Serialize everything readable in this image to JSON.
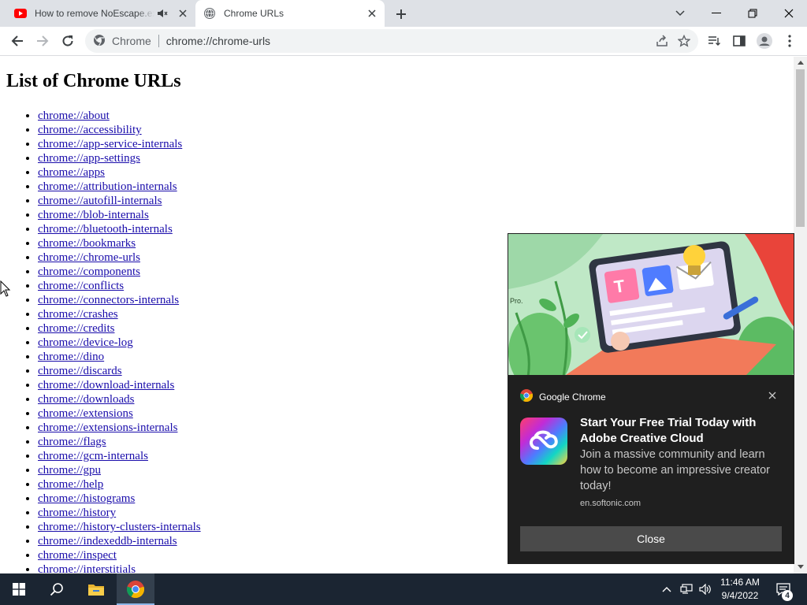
{
  "tabs": [
    {
      "title": "How to remove NoEscape.exe",
      "favicon": "youtube-icon",
      "extra_icon": "speaker-muted-icon",
      "active": false
    },
    {
      "title": "Chrome URLs",
      "favicon": "globe-icon",
      "active": true
    }
  ],
  "address_bar": {
    "site_chip": "Chrome",
    "url": "chrome://chrome-urls"
  },
  "page": {
    "heading": "List of Chrome URLs",
    "links": [
      "chrome://about",
      "chrome://accessibility",
      "chrome://app-service-internals",
      "chrome://app-settings",
      "chrome://apps",
      "chrome://attribution-internals",
      "chrome://autofill-internals",
      "chrome://blob-internals",
      "chrome://bluetooth-internals",
      "chrome://bookmarks",
      "chrome://chrome-urls",
      "chrome://components",
      "chrome://conflicts",
      "chrome://connectors-internals",
      "chrome://crashes",
      "chrome://credits",
      "chrome://device-log",
      "chrome://dino",
      "chrome://discards",
      "chrome://download-internals",
      "chrome://downloads",
      "chrome://extensions",
      "chrome://extensions-internals",
      "chrome://flags",
      "chrome://gcm-internals",
      "chrome://gpu",
      "chrome://help",
      "chrome://histograms",
      "chrome://history",
      "chrome://history-clusters-internals",
      "chrome://indexeddb-internals",
      "chrome://inspect",
      "chrome://interstitials"
    ]
  },
  "notification": {
    "app_name": "Google Chrome",
    "title": "Start Your Free Trial Today with Adobe Creative Cloud",
    "body": "Join a massive community and learn how to become an impressive creator today!",
    "source": "en.softonic.com",
    "button_label": "Close",
    "image_badge_text": "Pro."
  },
  "taskbar": {
    "time": "11:46 AM",
    "date": "9/4/2022",
    "notification_count": "4",
    "pinned": [
      "windows-start-icon",
      "search-icon",
      "file-explorer-icon",
      "chrome-icon"
    ]
  },
  "colors": {
    "tabstrip": "#dee1e6",
    "link": "#1a0dab",
    "notification_bg": "#1f1f1f",
    "taskbar_bg": "#1b2532"
  }
}
